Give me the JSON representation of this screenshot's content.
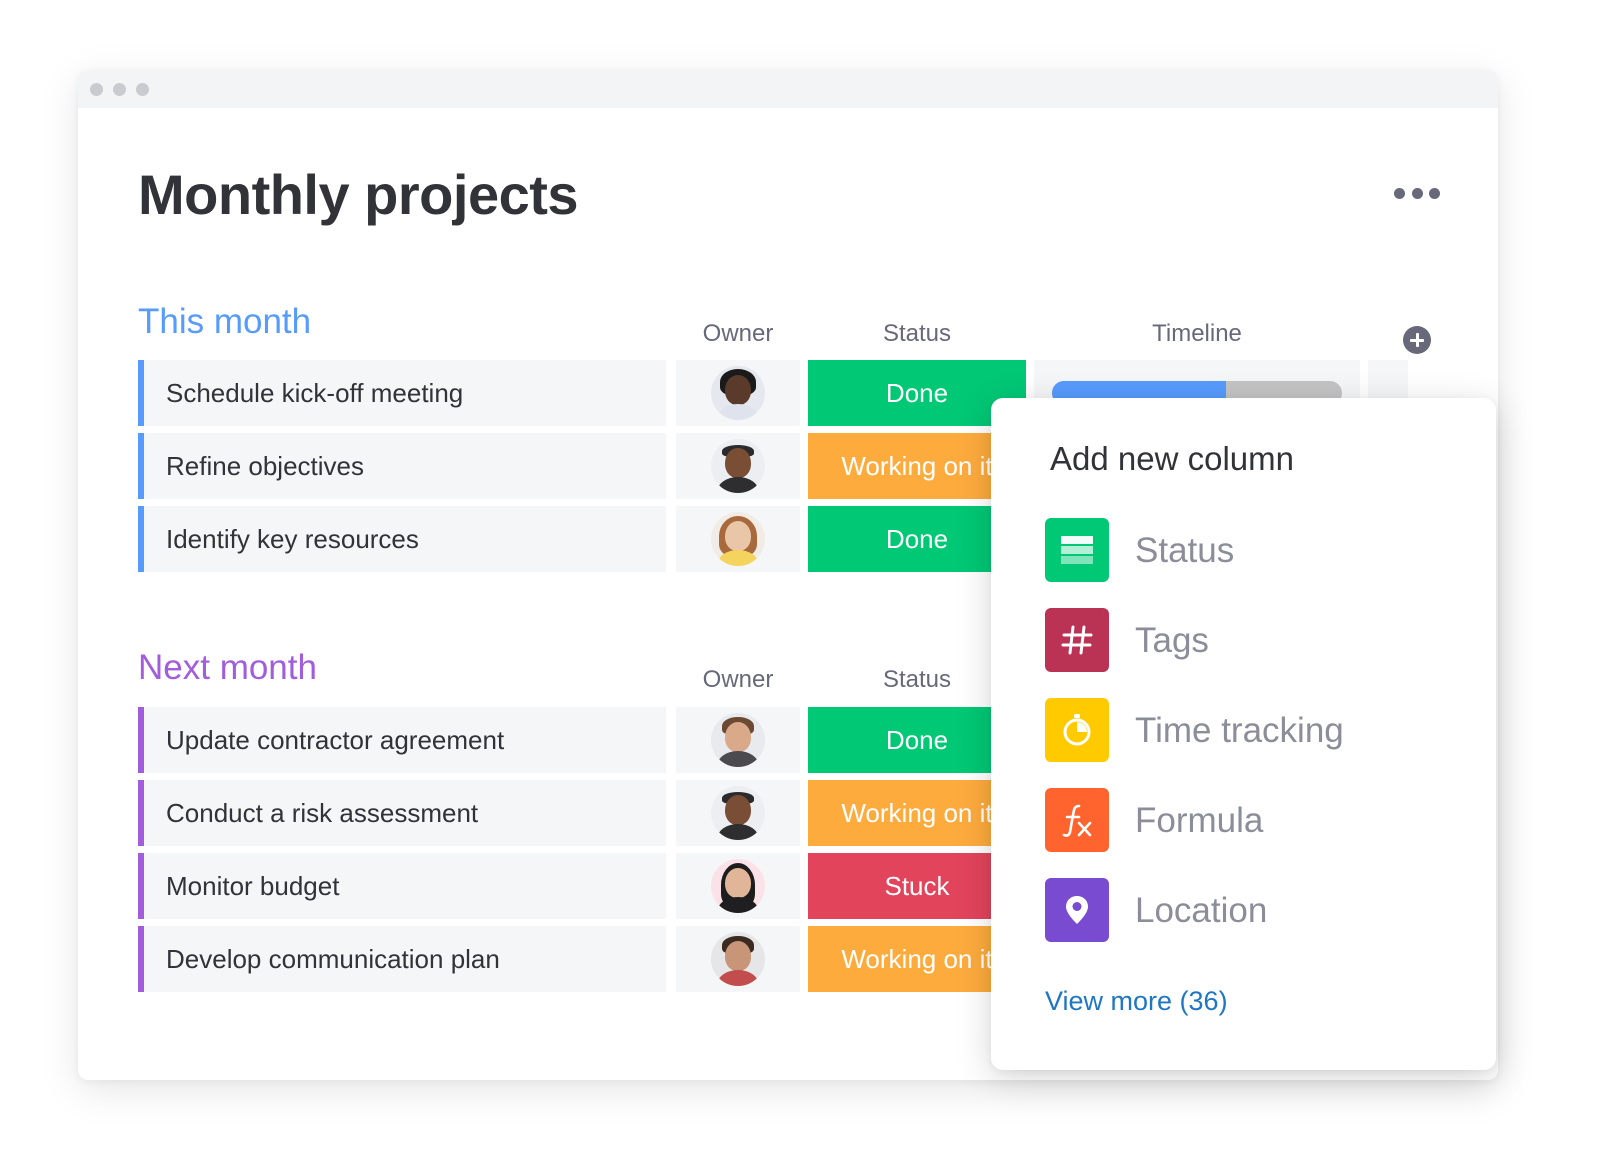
{
  "board": {
    "title": "Monthly projects"
  },
  "groups": [
    {
      "title": "This month",
      "color": "#579bfc",
      "columns": {
        "owner": "Owner",
        "status": "Status",
        "timeline": "Timeline"
      },
      "rows": [
        {
          "name": "Schedule kick-off meeting",
          "status": "Done",
          "status_color": "#00c875",
          "timeline_progress": 0.6
        },
        {
          "name": "Refine objectives",
          "status": "Working on it",
          "status_color": "#fdab3d"
        },
        {
          "name": "Identify key resources",
          "status": "Done",
          "status_color": "#00c875"
        }
      ]
    },
    {
      "title": "Next month",
      "color": "#a25ddc",
      "columns": {
        "owner": "Owner",
        "status": "Status"
      },
      "rows": [
        {
          "name": "Update contractor agreement",
          "status": "Done",
          "status_color": "#00c875"
        },
        {
          "name": "Conduct a risk assessment",
          "status": "Working on it",
          "status_color": "#fdab3d"
        },
        {
          "name": "Monitor budget",
          "status": "Stuck",
          "status_color": "#e2445c"
        },
        {
          "name": "Develop communication plan",
          "status": "Working on it",
          "status_color": "#fdab3d"
        }
      ]
    }
  ],
  "add_column_menu": {
    "title": "Add new column",
    "options": [
      {
        "label": "Status",
        "icon": "status-icon",
        "color": "#00c875"
      },
      {
        "label": "Tags",
        "icon": "hashtag-icon",
        "color": "#bb3354"
      },
      {
        "label": "Time tracking",
        "icon": "timer-icon",
        "color": "#ffcb00"
      },
      {
        "label": "Formula",
        "icon": "formula-icon",
        "color": "#ff642e"
      },
      {
        "label": "Location",
        "icon": "location-pin-icon",
        "color": "#784bd1"
      }
    ],
    "view_more": "View more (36)"
  }
}
